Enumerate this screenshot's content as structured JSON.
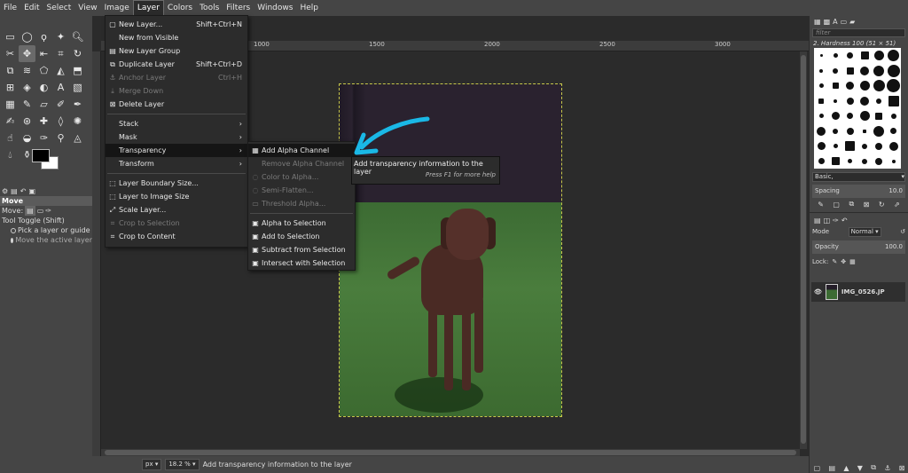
{
  "menubar": [
    "File",
    "Edit",
    "Select",
    "View",
    "Image",
    "Layer",
    "Colors",
    "Tools",
    "Filters",
    "Windows",
    "Help"
  ],
  "layer_menu": {
    "items": [
      {
        "label": "New Layer...",
        "shortcut": "Shift+Ctrl+N",
        "icon": "new-layer-icon",
        "disabled": false
      },
      {
        "label": "New from Visible",
        "shortcut": "",
        "icon": "",
        "disabled": false
      },
      {
        "label": "New Layer Group",
        "shortcut": "",
        "icon": "layer-group-icon",
        "disabled": false
      },
      {
        "label": "Duplicate Layer",
        "shortcut": "Shift+Ctrl+D",
        "icon": "duplicate-icon",
        "disabled": false
      },
      {
        "label": "Anchor Layer",
        "shortcut": "Ctrl+H",
        "icon": "anchor-icon",
        "disabled": true
      },
      {
        "label": "Merge Down",
        "shortcut": "",
        "icon": "merge-icon",
        "disabled": true
      },
      {
        "label": "Delete Layer",
        "shortcut": "",
        "icon": "delete-icon",
        "disabled": false
      }
    ],
    "submenus": [
      "Stack",
      "Mask",
      "Transparency",
      "Transform"
    ],
    "items2": [
      {
        "label": "Layer Boundary Size...",
        "icon": "boundary-icon",
        "disabled": false
      },
      {
        "label": "Layer to Image Size",
        "icon": "to-image-icon",
        "disabled": false
      },
      {
        "label": "Scale Layer...",
        "icon": "scale-icon",
        "disabled": false
      },
      {
        "label": "Crop to Selection",
        "icon": "crop-icon",
        "disabled": true
      },
      {
        "label": "Crop to Content",
        "icon": "crop-icon",
        "disabled": false
      }
    ]
  },
  "transparency_menu": {
    "items": [
      {
        "label": "Add Alpha Channel",
        "disabled": false
      },
      {
        "label": "Remove Alpha Channel",
        "disabled": true
      },
      {
        "label": "Color to Alpha...",
        "disabled": true
      },
      {
        "label": "Semi-Flatten...",
        "disabled": true
      },
      {
        "label": "Threshold Alpha...",
        "disabled": true
      }
    ],
    "items2": [
      {
        "label": "Alpha to Selection",
        "disabled": false
      },
      {
        "label": "Add to Selection",
        "disabled": false
      },
      {
        "label": "Subtract from Selection",
        "disabled": false
      },
      {
        "label": "Intersect with Selection",
        "disabled": false
      }
    ]
  },
  "tooltip": {
    "text": "Add transparency information to the layer",
    "hint": "Press F1 for more help"
  },
  "tool_options": {
    "title": "Move",
    "move_label": "Move:",
    "toggle_label": "Tool Toggle  (Shift)",
    "option1": "Pick a layer or guide",
    "option2": "Move the active layer"
  },
  "ruler": {
    "mark1": "1000",
    "mark2": "1500",
    "mark3": "2000",
    "mark4": "2500",
    "mark5": "3000"
  },
  "status": {
    "unit": "px",
    "zoom": "18.2 %",
    "message": "Add transparency information to the layer"
  },
  "brushes": {
    "filter_placeholder": "filter",
    "current": "2. Hardness 100 (51 × 51)",
    "preset": "Basic,",
    "spacing_label": "Spacing",
    "spacing_value": "10.0"
  },
  "layers": {
    "mode_label": "Mode",
    "mode_value": "Normal",
    "opacity_label": "Opacity",
    "opacity_value": "100.0",
    "lock_label": "Lock:",
    "layer_name": "IMG_0526.JP"
  },
  "colors": {
    "accent_arrow": "#1ab8e6",
    "menu_bg": "#2c2c2c",
    "app_bg": "#454545"
  }
}
